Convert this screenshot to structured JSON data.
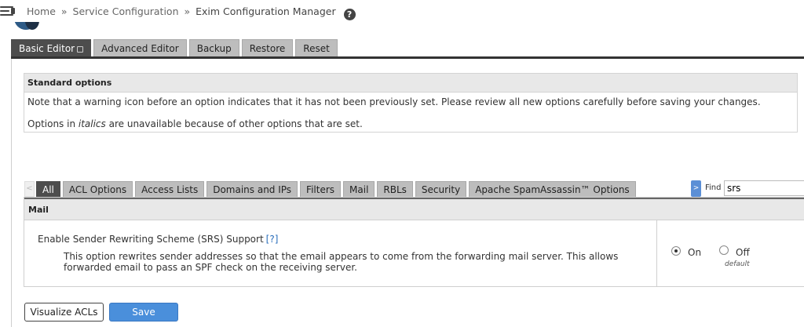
{
  "breadcrumb": {
    "home": "Home",
    "separator": "»",
    "section": "Service Configuration",
    "current": "Exim Configuration Manager",
    "help_icon": "question-circle-icon"
  },
  "main_tabs": [
    {
      "label": "Basic Editor",
      "active": true
    },
    {
      "label": "Advanced Editor",
      "active": false
    },
    {
      "label": "Backup",
      "active": false
    },
    {
      "label": "Restore",
      "active": false
    },
    {
      "label": "Reset",
      "active": false
    }
  ],
  "standard_options": {
    "title": "Standard options",
    "warning_text": "Note that a warning icon before an option indicates that it has not been previously set. Please review all new options carefully before saving your changes.",
    "italics_prefix": "Options in ",
    "italics_word": "italics",
    "italics_suffix": " are unavailable because of other options that are set."
  },
  "category_tabs": [
    {
      "label": "All",
      "active": true
    },
    {
      "label": "ACL Options",
      "active": false
    },
    {
      "label": "Access Lists",
      "active": false
    },
    {
      "label": "Domains and IPs",
      "active": false
    },
    {
      "label": "Filters",
      "active": false
    },
    {
      "label": "Mail",
      "active": false
    },
    {
      "label": "RBLs",
      "active": false
    },
    {
      "label": "Security",
      "active": false
    },
    {
      "label": "Apache SpamAssassin™ Options",
      "active": false
    }
  ],
  "scroll_left": "<",
  "find": {
    "toggle": ">",
    "label": "Find",
    "value": "srs"
  },
  "mail_section": {
    "title": "Mail",
    "option": {
      "title": "Enable Sender Rewriting Scheme (SRS) Support",
      "help_link": "[?]",
      "description": "This option rewrites sender addresses so that the email appears to come from the forwarding mail server. This allows forwarded email to pass an SPF check on the receiving server.",
      "on_label": "On",
      "off_label": "Off",
      "default_note": "default",
      "selected": "On"
    }
  },
  "buttons": {
    "visualize": "Visualize ACLs",
    "save": "Save"
  },
  "colors": {
    "active_tab": "#4d4d4d",
    "inactive_tab": "#bdbdbd",
    "save_button": "#4a8fdb",
    "link": "#2a6ebb"
  }
}
